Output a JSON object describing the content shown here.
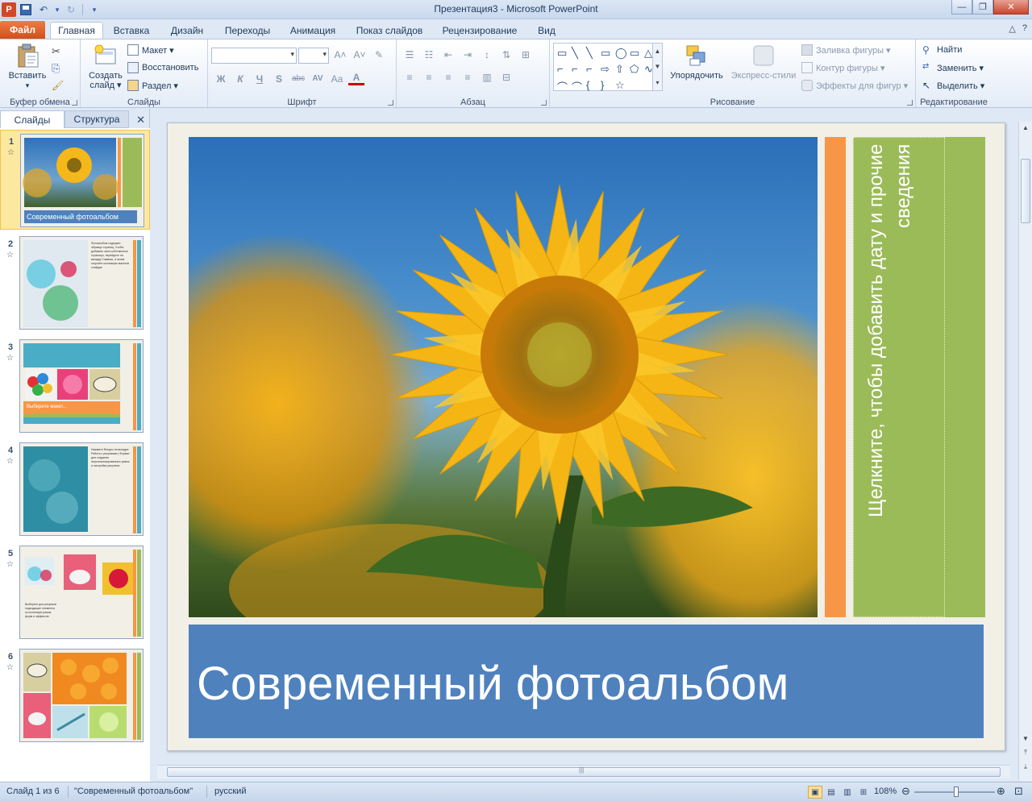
{
  "window": {
    "title": "Презентация3  -  Microsoft PowerPoint",
    "app_icon_letter": "P",
    "controls": {
      "minimize": "—",
      "maximize": "❐",
      "close": "✕"
    }
  },
  "quick_access": {
    "undo": "↶",
    "undo_dropdown": "▾",
    "redo": "↻",
    "customize": "▾"
  },
  "tabs": {
    "file": "Файл",
    "items": [
      "Главная",
      "Вставка",
      "Дизайн",
      "Переходы",
      "Анимация",
      "Показ слайдов",
      "Рецензирование",
      "Вид"
    ],
    "active_index": 0,
    "right_controls": [
      "△",
      "?"
    ]
  },
  "ribbon": {
    "clipboard": {
      "label": "Буфер обмена",
      "paste": "Вставить",
      "paste_dropdown": "▾",
      "cut": "✂",
      "copy": "⎘",
      "format_painter": "🖌"
    },
    "slides": {
      "label": "Слайды",
      "new_slide_line1": "Создать",
      "new_slide_line2": "слайд ▾",
      "layout": "Макет ▾",
      "reset": "Восстановить",
      "section": "Раздел ▾"
    },
    "font": {
      "label": "Шрифт",
      "font_name": "",
      "font_size": "",
      "grow": "A˄",
      "shrink": "A˅",
      "clear": "✎",
      "bold": "Ж",
      "italic": "К",
      "underline": "Ч",
      "shadow": "S",
      "strike": "abc",
      "spacing": "AV",
      "case": "Aa",
      "color": "A"
    },
    "paragraph": {
      "label": "Абзац",
      "row1": [
        "☰",
        "☷",
        "⇤",
        "⇥",
        "↕",
        "⇅",
        "⊞"
      ],
      "row2": [
        "≡",
        "≡",
        "≡",
        "≡",
        "▥",
        "⊟"
      ]
    },
    "drawing": {
      "label": "Рисование",
      "shapes": [
        "▭",
        "╲",
        "╲",
        "▭",
        "◯",
        "▭",
        "△",
        "⌐",
        "⌐",
        "⌐",
        "⇨",
        "⇧",
        "⬠",
        "∿",
        "⌒",
        "⌒",
        "{",
        "}",
        "☆"
      ],
      "gallery_scroll": [
        "▲",
        "▼",
        "▾"
      ],
      "arrange": "Упорядочить",
      "quick_styles": "Экспресс-стили",
      "shape_fill": "Заливка фигуры ▾",
      "shape_outline": "Контур фигуры ▾",
      "shape_effects": "Эффекты для фигур ▾"
    },
    "editing": {
      "label": "Редактирование",
      "find": "Найти",
      "replace": "Заменить ▾",
      "select": "Выделить ▾"
    }
  },
  "left_pane": {
    "tab_slides": "Слайды",
    "tab_outline": "Структура",
    "close": "✕",
    "slides": [
      {
        "num": "1",
        "title": "Современный фотоальбом"
      },
      {
        "num": "2",
        "text": "Фотоальбом содержит образцы страниц. Чтобы добавить свои собственные страницы, перейдите на вкладку Главная, а затем откройте коллекцию макетов слайдов"
      },
      {
        "num": "3",
        "text": "Выберите макет..."
      },
      {
        "num": "4",
        "text": "Нажмите Фигуры на вкладке Работа с рисунками | Формат для создания персонализированных рамок и настройки рисунков"
      },
      {
        "num": "5",
        "text": "Выберите для рисунков подходящие элементы из коллекции рамок, форм и эффектов"
      },
      {
        "num": "6"
      }
    ],
    "star": "☆"
  },
  "slide": {
    "vertical_text": "Щелкните, чтобы добавить дату и прочие сведения",
    "title": "Современный фотоальбом"
  },
  "scroll": {
    "up": "▲",
    "down": "▼",
    "prev": "⤒",
    "next": "⤓",
    "grip": "|||"
  },
  "statusbar": {
    "slide_info": "Слайд 1 из 6",
    "theme": "\"Современный фотоальбом\"",
    "language": "русский",
    "views": [
      "▣",
      "▤",
      "▥",
      "⊞"
    ],
    "zoom": "108%",
    "zoom_out": "⊖",
    "zoom_in": "⊕",
    "fit": "⊡"
  },
  "colors": {
    "orange": "#f79646",
    "green": "#9bbb59",
    "blue": "#4f81bd",
    "file_tab": "#d0501c"
  }
}
